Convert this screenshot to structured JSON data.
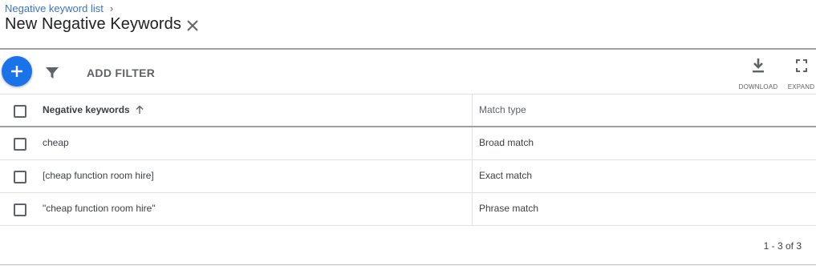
{
  "header": {
    "breadcrumb": "Negative keyword list",
    "breadcrumb_chevron": "›",
    "title": "New Negative Keywords"
  },
  "toolbar": {
    "add_filter_label": "ADD FILTER",
    "download_label": "DOWNLOAD",
    "expand_label": "EXPAND",
    "accent_color": "#1a73e8"
  },
  "table": {
    "columns": [
      "Negative keywords",
      "Match type"
    ],
    "rows": [
      {
        "keyword": "cheap",
        "match_type": "Broad match"
      },
      {
        "keyword": "[cheap function room hire]",
        "match_type": "Exact match"
      },
      {
        "keyword": "\"cheap function room hire\"",
        "match_type": "Phrase match"
      }
    ]
  },
  "footer": {
    "pagination": "1 - 3 of 3"
  },
  "icons": [
    "close-icon",
    "plus-icon",
    "filter-icon",
    "download-icon",
    "expand-icon",
    "arrow-up-icon"
  ]
}
